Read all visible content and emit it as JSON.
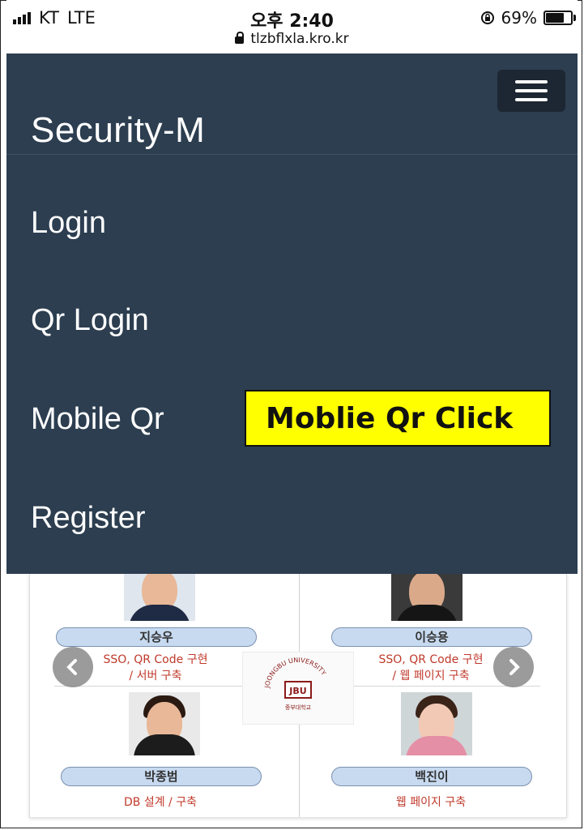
{
  "status_bar": {
    "carrier": "KT",
    "network": "LTE",
    "time": "오후 2:40",
    "url": "tlzbflxla.kro.kr",
    "battery_percent": "69%",
    "battery_level": 0.69,
    "icons": [
      "signal-icon",
      "lock-icon",
      "rotation-lock-icon",
      "battery-icon"
    ]
  },
  "navbar": {
    "brand": "Security-M",
    "toggler_icon": "hamburger-icon",
    "menu": [
      {
        "label": "Login"
      },
      {
        "label": "Qr Login"
      },
      {
        "label": "Mobile Qr"
      },
      {
        "label": "Register"
      }
    ],
    "background": "#2c3e50"
  },
  "callout": {
    "text": "Moblie Qr Click",
    "color": "#ffff00"
  },
  "team": {
    "members": [
      {
        "name": "지승우",
        "role_line1": "SSO, QR Code 구현",
        "role_line2": "/ 서버 구축"
      },
      {
        "name": "이승용",
        "role_line1": "SSO, QR Code 구현",
        "role_line2": "/ 웹 페이지 구축"
      },
      {
        "name": "박종범",
        "role_line1": "DB 설계 / 구축",
        "role_line2": ""
      },
      {
        "name": "백진이",
        "role_line1": "웹 페이지 구축",
        "role_line2": ""
      }
    ],
    "logo": {
      "arc_text": "JOONGBU UNIVERSITY",
      "mark": "JBU",
      "bottom_text": "중부대학교"
    },
    "carousel_icons": [
      "chevron-left-icon",
      "chevron-right-icon"
    ]
  }
}
